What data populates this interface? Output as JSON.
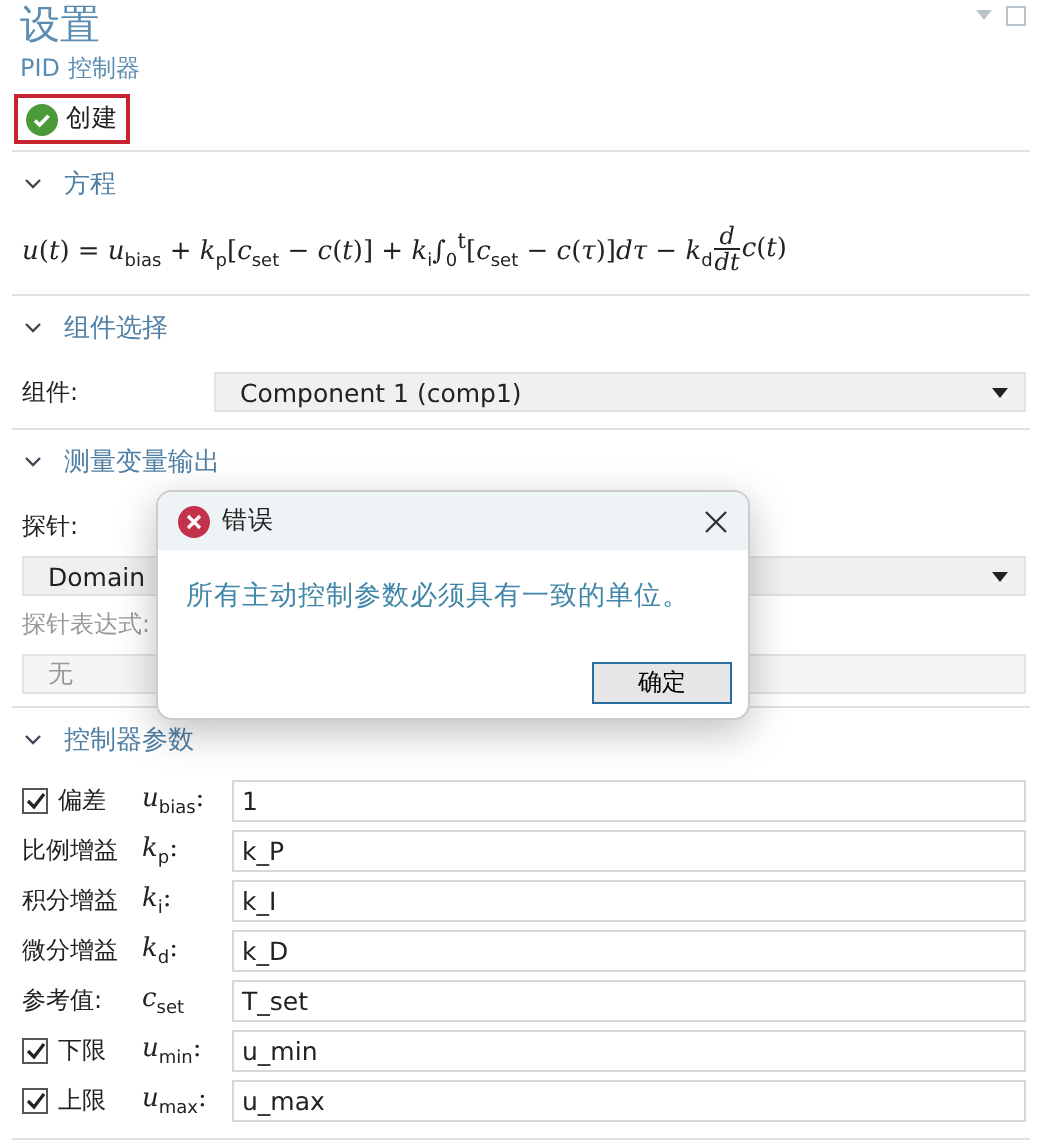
{
  "header": {
    "title": "设置",
    "subtitle": "PID 控制器",
    "create_button": "创建"
  },
  "sections": [
    {
      "kind": "equation",
      "title": "方程",
      "expanded": true,
      "equation": {
        "lead": "*u*(*t*) = *u*$_{bias}$ + *k*$_{p}$[*c*$_{set}$ − *c*(*t*)] + *k*$_{i}$∫$_{0}$$^{t}$[*c*$_{set}$ − *c*(*τ*)]*dτ* − *k*$_{d}$",
        "frac_num": "d",
        "frac_den": "dt",
        "tail": "*c*(*t*)"
      }
    },
    {
      "kind": "component",
      "title": "组件选择",
      "expanded": true,
      "label": "组件:",
      "value": "Component 1 (comp1)"
    },
    {
      "kind": "probe",
      "title": "测量变量输出",
      "expanded": true,
      "probe_label": "探针:",
      "probe_value": "Domain",
      "expr_label": "探针表达式:",
      "expr_value": "无",
      "expr_disabled": true
    },
    {
      "kind": "params",
      "title": "控制器参数",
      "expanded": true,
      "rows": [
        {
          "kind": "check",
          "label": "偏差",
          "checked": true,
          "symbol": "*u*$_{bias}$:",
          "value": "1"
        },
        {
          "kind": "plain",
          "label": "比例增益",
          "symbol": "*k*$_{p}$:",
          "value": "k_P"
        },
        {
          "kind": "plain",
          "label": "积分增益",
          "symbol": "*k*$_{i}$:",
          "value": "k_I"
        },
        {
          "kind": "plain",
          "label": "微分增益",
          "symbol": "*k*$_{d}$:",
          "value": "k_D"
        },
        {
          "kind": "plain",
          "label": "参考值:",
          "symbol": "*c*$_{set}$",
          "value": "T_set"
        },
        {
          "kind": "check",
          "label": "下限",
          "checked": true,
          "symbol": "*u*$_{min}$:",
          "value": "u_min"
        },
        {
          "kind": "check",
          "label": "上限",
          "checked": true,
          "symbol": "*u*$_{max}$:",
          "value": "u_max"
        }
      ]
    }
  ],
  "dialog": {
    "title": "错误",
    "message": "所有主动控制参数必须具有一致的单位。",
    "ok_button": "确定"
  }
}
